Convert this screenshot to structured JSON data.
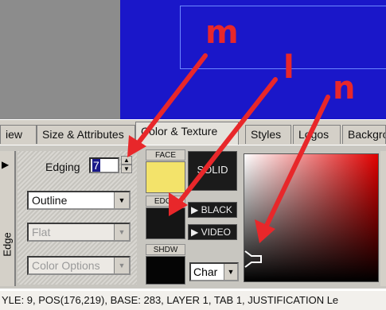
{
  "tabs": [
    {
      "label": "iew"
    },
    {
      "label": "Size & Attributes"
    },
    {
      "label": "Color & Texture"
    },
    {
      "label": "Styles"
    },
    {
      "label": "Logos"
    },
    {
      "label": "Backgro"
    }
  ],
  "left_panel": {
    "edge_label": "Edge",
    "edging_label": "Edging",
    "edging_value": "7",
    "outline_select": "Outline",
    "flat_select": "Flat",
    "color_options_select": "Color Options"
  },
  "swatches": {
    "face_label": "FACE",
    "edge_label": "EDGE",
    "shdw_label": "SHDW",
    "face_color": "#f3e36a",
    "edge_color": "#151515",
    "shdw_color": "#050505"
  },
  "buttons": {
    "solid": "SOLID",
    "black": "▶ BLACK",
    "video": "▶ VIDEO"
  },
  "char_select": "Char",
  "status_bar": "YLE: 9, POS(176,219), BASE: 283, LAYER 1, TAB 1, JUSTIFICATION Le",
  "annotations": {
    "m": "m",
    "l": "l",
    "n": "n",
    "color": "#e8272a"
  }
}
